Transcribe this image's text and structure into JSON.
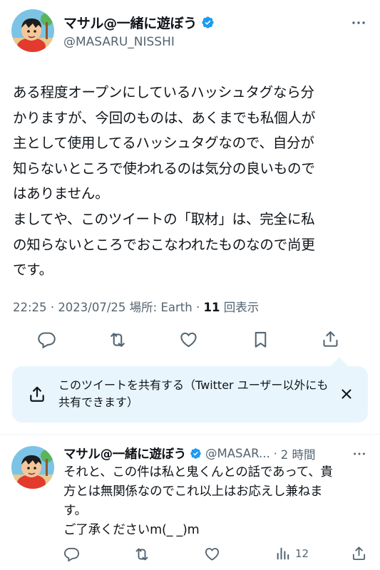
{
  "main_tweet": {
    "display_name": "マサル@一緒に遊ぼう",
    "handle": "@MASARU_NISSHI",
    "body": "ある程度オープンにしているハッシュタグなら分\nかりますが、今回のものは、あくまでも私個人が\n主として使用してるハッシュタグなので、自分が\n知らないところで使われるのは気分の良いもので\nはありません。\nましてや、このツイートの「取材」は、完全に私\nの知らないところでおこなわれたものなので尚更\nです。",
    "meta": {
      "time": "22:25",
      "date": "2023/07/25",
      "location_label": "場所: Earth",
      "views_count": "11",
      "views_label": "回表示"
    },
    "actions": [
      "reply-icon",
      "retweet-icon",
      "like-icon",
      "bookmark-icon",
      "share-icon"
    ]
  },
  "share_callout": {
    "text": "このツイートを共有する（Twitter ユーザー以外にも共有できます）"
  },
  "reply_tweet": {
    "display_name": "マサル@一緒に遊ぼう",
    "handle": "@MASAR...",
    "time": "2 時間",
    "body": "それと、この件は私と鬼くんとの話であって、貴\n方とは無関係なのでこれ以上はお応えし兼ねま\nす。\nご了承くださいm(_ _)m",
    "views_count": "12"
  },
  "colors": {
    "text": "#0f1419",
    "secondary": "#536471",
    "verified": "#1d9bf0",
    "callout_bg": "#e8f5fd"
  }
}
